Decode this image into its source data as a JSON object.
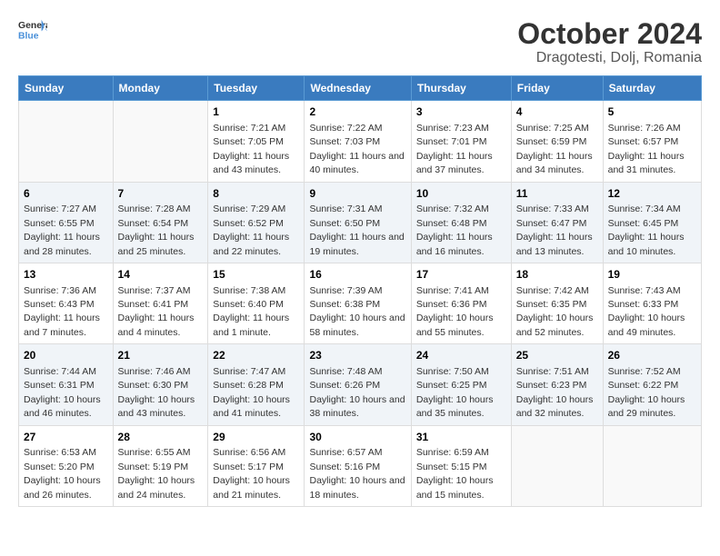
{
  "logo": {
    "text_general": "General",
    "text_blue": "Blue"
  },
  "title": "October 2024",
  "subtitle": "Dragotesti, Dolj, Romania",
  "weekdays": [
    "Sunday",
    "Monday",
    "Tuesday",
    "Wednesday",
    "Thursday",
    "Friday",
    "Saturday"
  ],
  "weeks": [
    [
      {
        "day": "",
        "sunrise": "",
        "sunset": "",
        "daylight": ""
      },
      {
        "day": "",
        "sunrise": "",
        "sunset": "",
        "daylight": ""
      },
      {
        "day": "1",
        "sunrise": "Sunrise: 7:21 AM",
        "sunset": "Sunset: 7:05 PM",
        "daylight": "Daylight: 11 hours and 43 minutes."
      },
      {
        "day": "2",
        "sunrise": "Sunrise: 7:22 AM",
        "sunset": "Sunset: 7:03 PM",
        "daylight": "Daylight: 11 hours and 40 minutes."
      },
      {
        "day": "3",
        "sunrise": "Sunrise: 7:23 AM",
        "sunset": "Sunset: 7:01 PM",
        "daylight": "Daylight: 11 hours and 37 minutes."
      },
      {
        "day": "4",
        "sunrise": "Sunrise: 7:25 AM",
        "sunset": "Sunset: 6:59 PM",
        "daylight": "Daylight: 11 hours and 34 minutes."
      },
      {
        "day": "5",
        "sunrise": "Sunrise: 7:26 AM",
        "sunset": "Sunset: 6:57 PM",
        "daylight": "Daylight: 11 hours and 31 minutes."
      }
    ],
    [
      {
        "day": "6",
        "sunrise": "Sunrise: 7:27 AM",
        "sunset": "Sunset: 6:55 PM",
        "daylight": "Daylight: 11 hours and 28 minutes."
      },
      {
        "day": "7",
        "sunrise": "Sunrise: 7:28 AM",
        "sunset": "Sunset: 6:54 PM",
        "daylight": "Daylight: 11 hours and 25 minutes."
      },
      {
        "day": "8",
        "sunrise": "Sunrise: 7:29 AM",
        "sunset": "Sunset: 6:52 PM",
        "daylight": "Daylight: 11 hours and 22 minutes."
      },
      {
        "day": "9",
        "sunrise": "Sunrise: 7:31 AM",
        "sunset": "Sunset: 6:50 PM",
        "daylight": "Daylight: 11 hours and 19 minutes."
      },
      {
        "day": "10",
        "sunrise": "Sunrise: 7:32 AM",
        "sunset": "Sunset: 6:48 PM",
        "daylight": "Daylight: 11 hours and 16 minutes."
      },
      {
        "day": "11",
        "sunrise": "Sunrise: 7:33 AM",
        "sunset": "Sunset: 6:47 PM",
        "daylight": "Daylight: 11 hours and 13 minutes."
      },
      {
        "day": "12",
        "sunrise": "Sunrise: 7:34 AM",
        "sunset": "Sunset: 6:45 PM",
        "daylight": "Daylight: 11 hours and 10 minutes."
      }
    ],
    [
      {
        "day": "13",
        "sunrise": "Sunrise: 7:36 AM",
        "sunset": "Sunset: 6:43 PM",
        "daylight": "Daylight: 11 hours and 7 minutes."
      },
      {
        "day": "14",
        "sunrise": "Sunrise: 7:37 AM",
        "sunset": "Sunset: 6:41 PM",
        "daylight": "Daylight: 11 hours and 4 minutes."
      },
      {
        "day": "15",
        "sunrise": "Sunrise: 7:38 AM",
        "sunset": "Sunset: 6:40 PM",
        "daylight": "Daylight: 11 hours and 1 minute."
      },
      {
        "day": "16",
        "sunrise": "Sunrise: 7:39 AM",
        "sunset": "Sunset: 6:38 PM",
        "daylight": "Daylight: 10 hours and 58 minutes."
      },
      {
        "day": "17",
        "sunrise": "Sunrise: 7:41 AM",
        "sunset": "Sunset: 6:36 PM",
        "daylight": "Daylight: 10 hours and 55 minutes."
      },
      {
        "day": "18",
        "sunrise": "Sunrise: 7:42 AM",
        "sunset": "Sunset: 6:35 PM",
        "daylight": "Daylight: 10 hours and 52 minutes."
      },
      {
        "day": "19",
        "sunrise": "Sunrise: 7:43 AM",
        "sunset": "Sunset: 6:33 PM",
        "daylight": "Daylight: 10 hours and 49 minutes."
      }
    ],
    [
      {
        "day": "20",
        "sunrise": "Sunrise: 7:44 AM",
        "sunset": "Sunset: 6:31 PM",
        "daylight": "Daylight: 10 hours and 46 minutes."
      },
      {
        "day": "21",
        "sunrise": "Sunrise: 7:46 AM",
        "sunset": "Sunset: 6:30 PM",
        "daylight": "Daylight: 10 hours and 43 minutes."
      },
      {
        "day": "22",
        "sunrise": "Sunrise: 7:47 AM",
        "sunset": "Sunset: 6:28 PM",
        "daylight": "Daylight: 10 hours and 41 minutes."
      },
      {
        "day": "23",
        "sunrise": "Sunrise: 7:48 AM",
        "sunset": "Sunset: 6:26 PM",
        "daylight": "Daylight: 10 hours and 38 minutes."
      },
      {
        "day": "24",
        "sunrise": "Sunrise: 7:50 AM",
        "sunset": "Sunset: 6:25 PM",
        "daylight": "Daylight: 10 hours and 35 minutes."
      },
      {
        "day": "25",
        "sunrise": "Sunrise: 7:51 AM",
        "sunset": "Sunset: 6:23 PM",
        "daylight": "Daylight: 10 hours and 32 minutes."
      },
      {
        "day": "26",
        "sunrise": "Sunrise: 7:52 AM",
        "sunset": "Sunset: 6:22 PM",
        "daylight": "Daylight: 10 hours and 29 minutes."
      }
    ],
    [
      {
        "day": "27",
        "sunrise": "Sunrise: 6:53 AM",
        "sunset": "Sunset: 5:20 PM",
        "daylight": "Daylight: 10 hours and 26 minutes."
      },
      {
        "day": "28",
        "sunrise": "Sunrise: 6:55 AM",
        "sunset": "Sunset: 5:19 PM",
        "daylight": "Daylight: 10 hours and 24 minutes."
      },
      {
        "day": "29",
        "sunrise": "Sunrise: 6:56 AM",
        "sunset": "Sunset: 5:17 PM",
        "daylight": "Daylight: 10 hours and 21 minutes."
      },
      {
        "day": "30",
        "sunrise": "Sunrise: 6:57 AM",
        "sunset": "Sunset: 5:16 PM",
        "daylight": "Daylight: 10 hours and 18 minutes."
      },
      {
        "day": "31",
        "sunrise": "Sunrise: 6:59 AM",
        "sunset": "Sunset: 5:15 PM",
        "daylight": "Daylight: 10 hours and 15 minutes."
      },
      {
        "day": "",
        "sunrise": "",
        "sunset": "",
        "daylight": ""
      },
      {
        "day": "",
        "sunrise": "",
        "sunset": "",
        "daylight": ""
      }
    ]
  ]
}
